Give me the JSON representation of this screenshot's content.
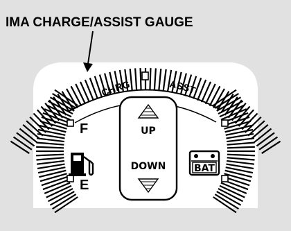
{
  "caption": "IMA CHARGE/ASSIST GAUGE",
  "top_gauge": {
    "left_label": "CHRG",
    "right_label": "ASST"
  },
  "fuel_gauge": {
    "full_label": "F",
    "empty_label": "E"
  },
  "shift_indicator": {
    "up_label": "UP",
    "down_label": "DOWN"
  },
  "battery_gauge": {
    "label": "BAT"
  },
  "colors": {
    "panel_background": "#e1e1e1",
    "dial_face": "#ffffff",
    "ink": "#000000"
  },
  "icons": [
    "fuel-pump-icon",
    "battery-icon",
    "up-arrow-icon",
    "down-arrow-icon",
    "pointer-arrow-icon"
  ]
}
